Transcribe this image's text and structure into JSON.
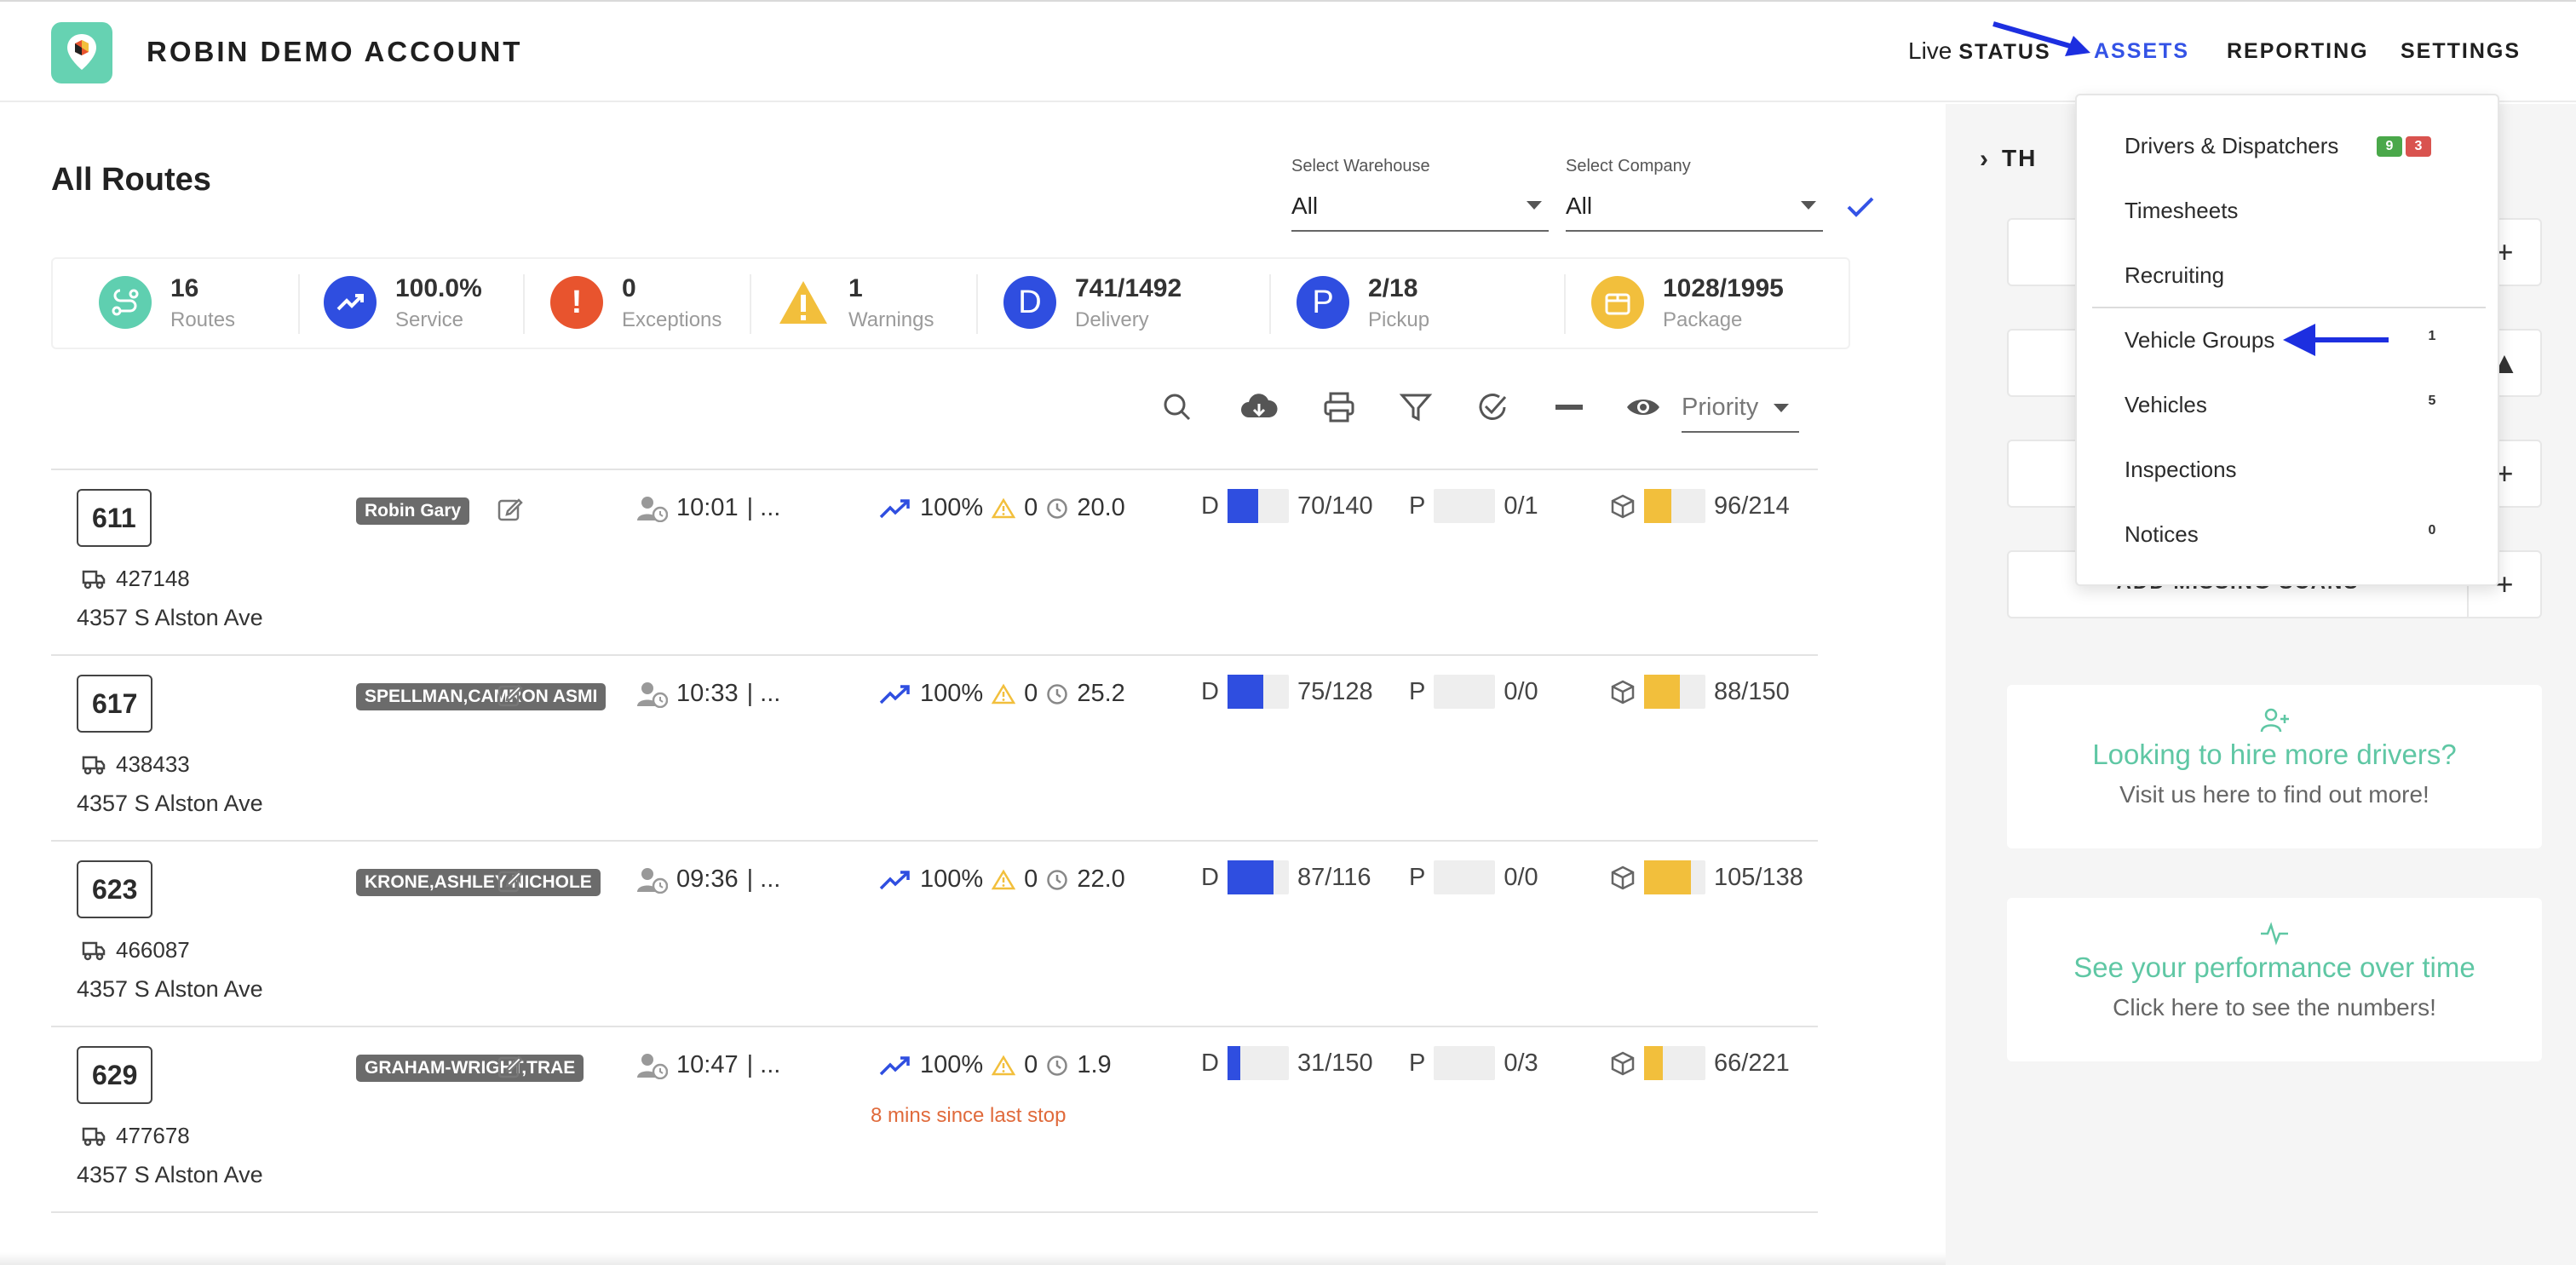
{
  "header": {
    "brand": "ROBIN DEMO ACCOUNT",
    "nav": {
      "live_prefix": "Live",
      "live_status": "STATUS",
      "assets": "ASSETS",
      "reporting": "REPORTING",
      "settings": "SETTINGS"
    }
  },
  "main": {
    "title": "All Routes",
    "filters": {
      "warehouse_label": "Select Warehouse",
      "warehouse_value": "All",
      "company_label": "Select Company",
      "company_value": "All"
    },
    "stats": [
      {
        "value": "16",
        "label": "Routes",
        "color": "#5fcfb0",
        "icon": "route-icon"
      },
      {
        "value": "100.0%",
        "label": "Service",
        "color": "#2f4ee0",
        "icon": "trending-up-icon"
      },
      {
        "value": "0",
        "label": "Exceptions",
        "color": "#e8542e",
        "icon": "exclamation-icon"
      },
      {
        "value": "1",
        "label": "Warnings",
        "color": "#f2bf3c",
        "icon": "warning-icon"
      },
      {
        "value": "741/1492",
        "label": "Delivery",
        "color": "#2f4ee0",
        "icon_text": "D"
      },
      {
        "value": "2/18",
        "label": "Pickup",
        "color": "#2f4ee0",
        "icon_text": "P"
      },
      {
        "value": "1028/1995",
        "label": "Package",
        "color": "#f2bf3c",
        "icon": "package-icon"
      }
    ],
    "sort": {
      "value": "Priority"
    },
    "routes": [
      {
        "route": "611",
        "vehicle": "427148",
        "address": "4357 S Alston Ave",
        "driver": "Robin Gary",
        "time": "10:01",
        "time_suffix": "| ...",
        "service": "100%",
        "warnings": "0",
        "duration": "20.0",
        "d_prefix": "D",
        "delivery": "70/140",
        "delivery_fraction": 0.5,
        "p_prefix": "P",
        "pickup": "0/1",
        "pickup_fraction": 0,
        "package": "96/214",
        "package_fraction": 0.45,
        "note": ""
      },
      {
        "route": "617",
        "vehicle": "438433",
        "address": "4357 S Alston Ave",
        "driver": "SPELLMAN,CAMRON ASMI",
        "time": "10:33",
        "time_suffix": "| ...",
        "service": "100%",
        "warnings": "0",
        "duration": "25.2",
        "d_prefix": "D",
        "delivery": "75/128",
        "delivery_fraction": 0.59,
        "p_prefix": "P",
        "pickup": "0/0",
        "pickup_fraction": 0,
        "package": "88/150",
        "package_fraction": 0.59,
        "note": ""
      },
      {
        "route": "623",
        "vehicle": "466087",
        "address": "4357 S Alston Ave",
        "driver": "KRONE,ASHLEY NICHOLE",
        "time": "09:36",
        "time_suffix": "| ...",
        "service": "100%",
        "warnings": "0",
        "duration": "22.0",
        "d_prefix": "D",
        "delivery": "87/116",
        "delivery_fraction": 0.75,
        "p_prefix": "P",
        "pickup": "0/0",
        "pickup_fraction": 0,
        "package": "105/138",
        "package_fraction": 0.76,
        "note": ""
      },
      {
        "route": "629",
        "vehicle": "477678",
        "address": "4357 S Alston Ave",
        "driver": "GRAHAM-WRIGHT,TRAE",
        "time": "10:47",
        "time_suffix": "| ...",
        "service": "100%",
        "warnings": "0",
        "duration": "1.9",
        "d_prefix": "D",
        "delivery": "31/150",
        "delivery_fraction": 0.21,
        "p_prefix": "P",
        "pickup": "0/3",
        "pickup_fraction": 0,
        "package": "66/221",
        "package_fraction": 0.3,
        "note": "8 mins since last stop"
      }
    ]
  },
  "right_panel": {
    "title_partial": "TH",
    "box_label_bottom": "ADD MISSING SCANS",
    "hire_card": {
      "heading": "Looking to hire more drivers?",
      "sub": "Visit us here to find out more!"
    },
    "perf_card": {
      "heading": "See your performance over time",
      "sub": "Click here to see the numbers!"
    }
  },
  "assets_menu": {
    "items": [
      {
        "label": "Drivers & Dispatchers",
        "badge_green": "9",
        "badge_red": "3"
      },
      {
        "label": "Timesheets"
      },
      {
        "label": "Recruiting"
      },
      {
        "label": "Vehicle Groups",
        "count": "1"
      },
      {
        "label": "Vehicles",
        "count": "5"
      },
      {
        "label": "Inspections"
      },
      {
        "label": "Notices",
        "count": "0"
      }
    ]
  },
  "colors": {
    "accent": "#3453e6",
    "teal": "#66d2b2",
    "delivery_bar": "#2f4ee0",
    "package_bar": "#f2bf3c",
    "annotation_arrow": "#1d2fe0"
  }
}
